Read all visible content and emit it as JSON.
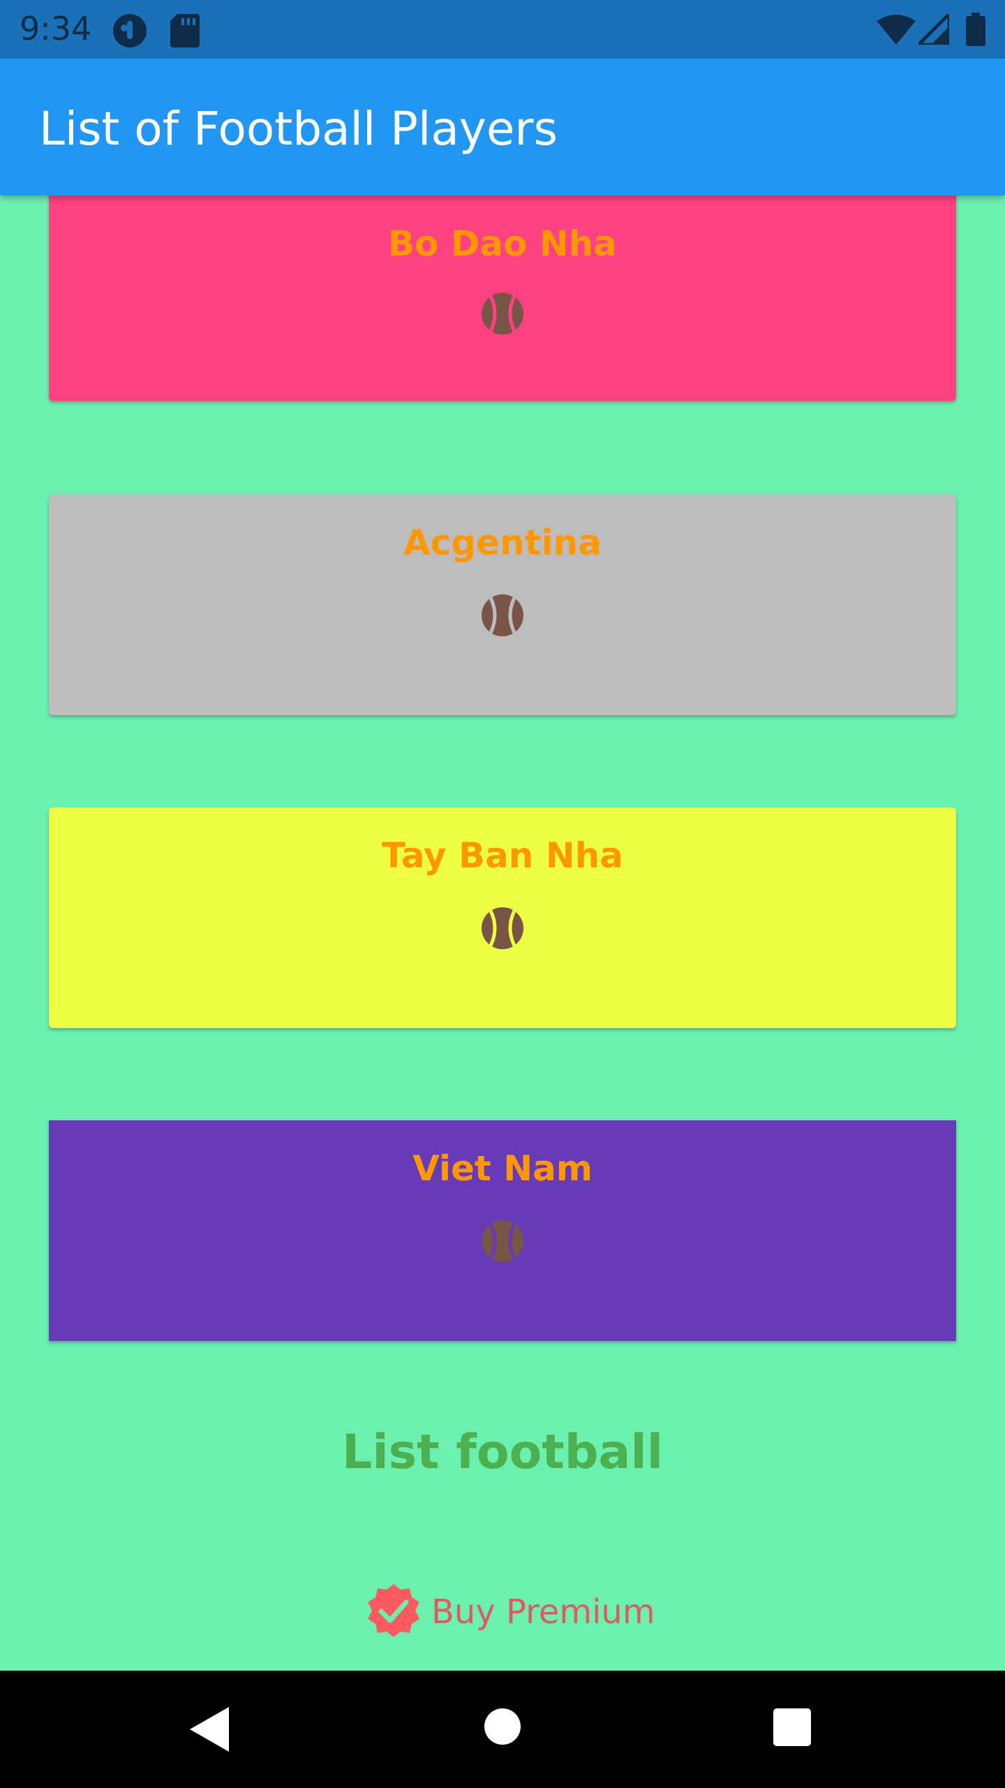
{
  "status_bar": {
    "time": "9:34",
    "icons": [
      "media-icon",
      "sd-card-icon",
      "wifi-icon",
      "signal-icon",
      "battery-icon"
    ]
  },
  "app_bar": {
    "title": "List of Football Players"
  },
  "cards": [
    {
      "title": "Bo Dao Nha",
      "color": "#ff4081",
      "icon": "sports-ball-icon"
    },
    {
      "title": "Acgentina",
      "color": "#bdbdbd",
      "icon": "sports-ball-icon"
    },
    {
      "title": "Tay Ban Nha",
      "color": "#eeff41",
      "icon": "sports-ball-icon"
    },
    {
      "title": "Viet Nam",
      "color": "#673ab7",
      "icon": "sports-ball-icon"
    }
  ],
  "footer": {
    "title": "List football",
    "premium_label": "Buy Premium",
    "premium_icon": "verified-badge-icon"
  },
  "nav_bar": {
    "buttons": [
      "back-icon",
      "home-icon",
      "recents-icon"
    ]
  },
  "colors": {
    "background": "#6cf0b0",
    "app_bar": "#2196f3",
    "card_title": "#ff9800",
    "footer_title": "#4caf50",
    "premium": "#e05a64"
  }
}
